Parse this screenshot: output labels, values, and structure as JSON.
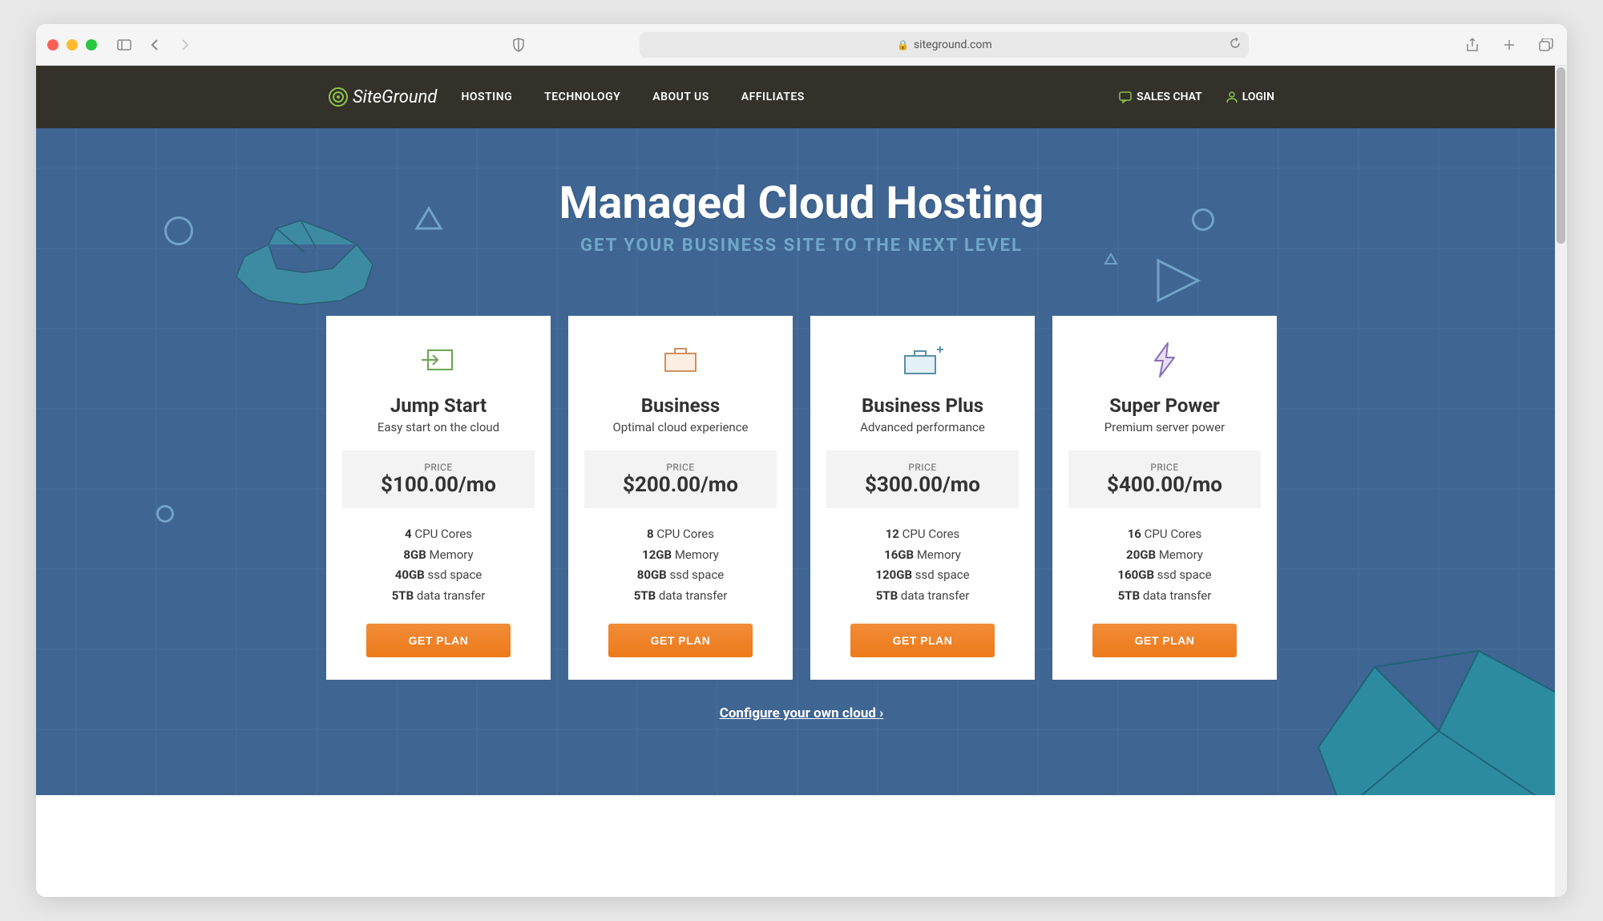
{
  "browser": {
    "url": "siteground.com"
  },
  "nav": {
    "brand": "SiteGround",
    "links": [
      "HOSTING",
      "TECHNOLOGY",
      "ABOUT US",
      "AFFILIATES"
    ],
    "sales_chat": "SALES CHAT",
    "login": "LOGIN"
  },
  "hero": {
    "title": "Managed Cloud Hosting",
    "subtitle": "GET YOUR BUSINESS SITE TO THE NEXT LEVEL"
  },
  "price_label": "PRICE",
  "cta_label": "GET PLAN",
  "plans": [
    {
      "name": "Jump Start",
      "tagline": "Easy start on the cloud",
      "price": "$100.00/mo",
      "cpu_val": "4",
      "cpu_txt": " CPU Cores",
      "mem_val": "8GB",
      "mem_txt": " Memory",
      "ssd_val": "40GB",
      "ssd_txt": " ssd space",
      "xfer_val": "5TB",
      "xfer_txt": " data transfer"
    },
    {
      "name": "Business",
      "tagline": "Optimal cloud experience",
      "price": "$200.00/mo",
      "cpu_val": "8",
      "cpu_txt": " CPU Cores",
      "mem_val": "12GB",
      "mem_txt": " Memory",
      "ssd_val": "80GB",
      "ssd_txt": " ssd space",
      "xfer_val": "5TB",
      "xfer_txt": " data transfer"
    },
    {
      "name": "Business Plus",
      "tagline": "Advanced performance",
      "price": "$300.00/mo",
      "cpu_val": "12",
      "cpu_txt": " CPU Cores",
      "mem_val": "16GB",
      "mem_txt": " Memory",
      "ssd_val": "120GB",
      "ssd_txt": " ssd space",
      "xfer_val": "5TB",
      "xfer_txt": " data transfer"
    },
    {
      "name": "Super Power",
      "tagline": "Premium server power",
      "price": "$400.00/mo",
      "cpu_val": "16",
      "cpu_txt": " CPU Cores",
      "mem_val": "20GB",
      "mem_txt": " Memory",
      "ssd_val": "160GB",
      "ssd_txt": " ssd space",
      "xfer_val": "5TB",
      "xfer_txt": " data transfer"
    }
  ],
  "configure_link": "Configure your own cloud"
}
